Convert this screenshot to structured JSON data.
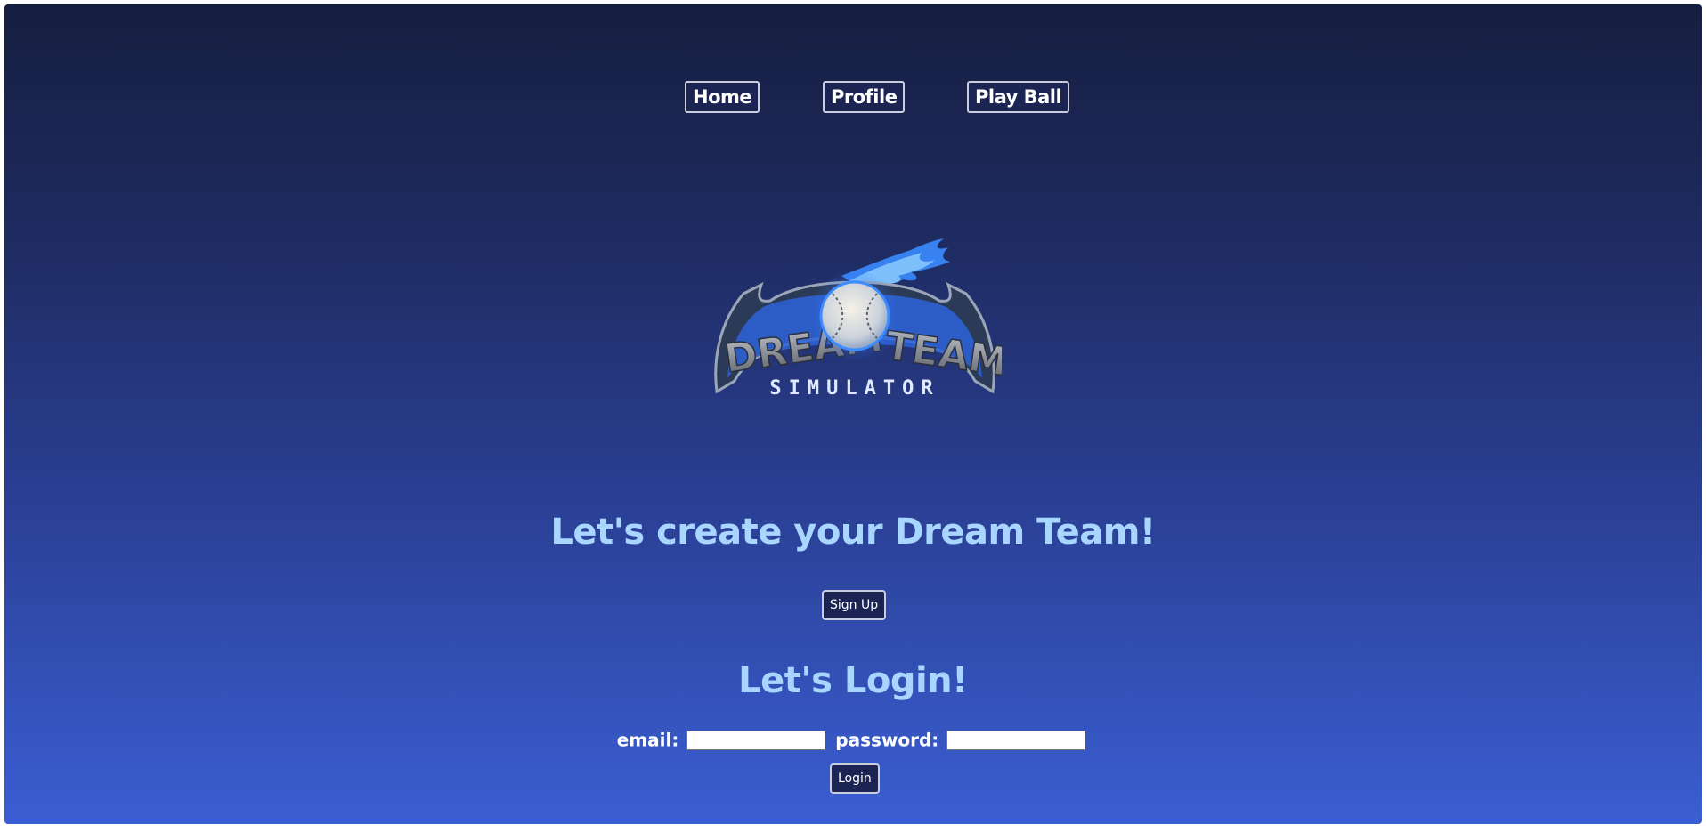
{
  "nav": {
    "items": [
      {
        "label": "Home"
      },
      {
        "label": "Profile"
      },
      {
        "label": "Play Ball"
      }
    ]
  },
  "logo": {
    "line1_left": "DREAM",
    "line1_right": "TEAM",
    "line2": "SIMULATOR"
  },
  "signup_section": {
    "heading": "Let's create your Dream Team!",
    "button_label": "Sign Up"
  },
  "login_section": {
    "heading": "Let's Login!",
    "email_label": "email:",
    "email_value": "",
    "password_label": "password:",
    "password_value": "",
    "button_label": "Login"
  },
  "colors": {
    "background_top": "#161e40",
    "background_bottom": "#3a5ed2",
    "heading": "#a9d6ff",
    "button_bg": "#1b2452",
    "button_border": "#c9cddd"
  }
}
